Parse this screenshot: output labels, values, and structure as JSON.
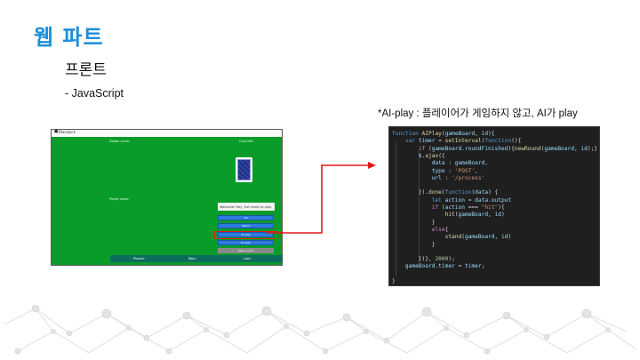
{
  "slide": {
    "title": "웹 파트",
    "subtitle": "프론트",
    "bullet": "- JavaScript",
    "caption": "*AI-play : 플레이어가 게임하지 않고, AI가 play"
  },
  "game_screenshot": {
    "app_name": "Blackjack",
    "dealer_label": "Dealer score:",
    "deck_label": "Card left:",
    "player_label": "Player score:",
    "message": "Welcome! Hey, Get ready to play.",
    "buttons": [
      "Hit",
      "Stand",
      "AI play",
      "AI Loop"
    ],
    "new_round": "New round",
    "stats": [
      "Played:",
      "Won:",
      "Lost:"
    ]
  },
  "code": {
    "lines": [
      "function AIPlay(gameBoard, id){",
      "    var timer = setInterval(function(){",
      "        if (gameBoard.roundFinished){newRound(gameBoard, id);}",
      "        $.ajax({",
      "            data : gameBoard,",
      "            type : 'POST',",
      "            url : '/process'",
      "",
      "        }).done(function(data) {",
      "            let action = data.output",
      "            if (action === \"hit\"){",
      "                hit(gameBoard, id)",
      "            }",
      "            else{",
      "                stand(gameBoard, id)",
      "            }",
      "",
      "        })}, 2000);",
      "    gameBoard.timer = timer;",
      "",
      "}"
    ]
  },
  "colors": {
    "title": "#1b8fd8",
    "table_green": "#0a9c2a",
    "highlight_red": "#e01818",
    "code_bg": "#1f1f1f"
  }
}
